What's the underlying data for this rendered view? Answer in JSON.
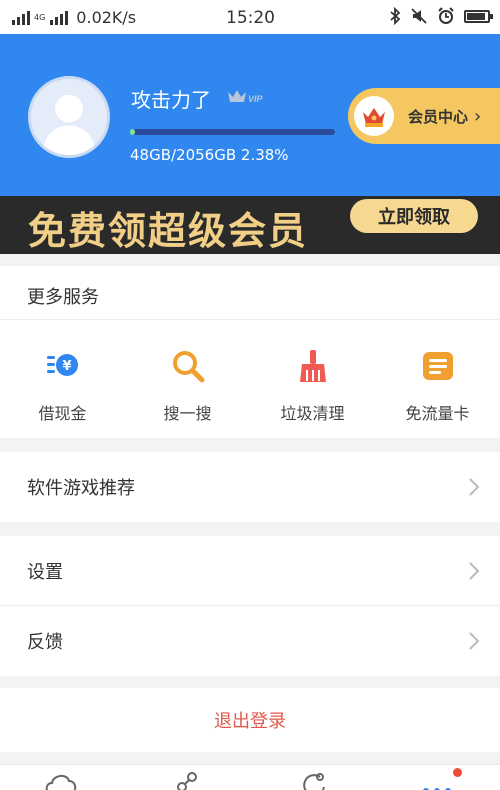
{
  "status_bar": {
    "net_type": "4G",
    "speed": "0.02K/s",
    "time": "15:20",
    "battery_level": 0.9
  },
  "profile": {
    "username": "攻击力了",
    "vip_label": "VIP",
    "storage_text": "48GB/2056GB 2.38%",
    "storage_fraction": 0.0238,
    "member_center_label": "会员中心"
  },
  "banner": {
    "text": "免费领超级会员",
    "button_label": "立即领取"
  },
  "services": {
    "title": "更多服务",
    "items": [
      {
        "label": "借现金",
        "icon": "cash-loan-icon",
        "color": "#2f87ef"
      },
      {
        "label": "搜一搜",
        "icon": "search-icon",
        "color": "#f0a030"
      },
      {
        "label": "垃圾清理",
        "icon": "broom-icon",
        "color": "#ef5a55"
      },
      {
        "label": "免流量卡",
        "icon": "data-card-icon",
        "color": "#f0a030"
      }
    ]
  },
  "menu": {
    "software_games": "软件游戏推荐",
    "settings": "设置",
    "feedback": "反馈",
    "logout": "退出登录"
  },
  "colors": {
    "header_blue": "#2f87ef",
    "gold": "#f4c761",
    "logout_red": "#e05a4c"
  }
}
